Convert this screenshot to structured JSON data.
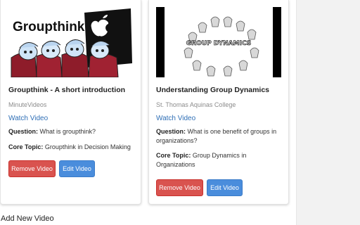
{
  "videos": [
    {
      "title": "Groupthink - A short introduction",
      "source": "MinuteVideos",
      "watch_label": "Watch Video",
      "question_label": "Question:",
      "question": "What is groupthink?",
      "topic_label": "Core Topic:",
      "topic": "Groupthink in Decision Making",
      "remove_label": "Remove Video",
      "edit_label": "Edit Video",
      "thumbnail_text": "Groupthink"
    },
    {
      "title": "Understanding Group Dynamics",
      "source": "St. Thomas Aquinas College",
      "watch_label": "Watch Video",
      "question_label": "Question:",
      "question": "What is one benefit of groups in organizations?",
      "topic_label": "Core Topic:",
      "topic": "Group Dynamics in Organizations",
      "remove_label": "Remove Video",
      "edit_label": "Edit Video",
      "thumbnail_text": "GROUP DYNAMICS"
    }
  ],
  "add_new_label": "Add New Video",
  "colors": {
    "remove_button": "#d9534f",
    "edit_button": "#4a8ddc",
    "link": "#2f6fb6"
  }
}
